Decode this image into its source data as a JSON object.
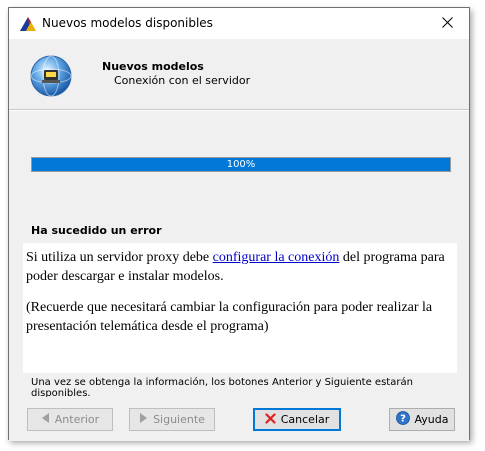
{
  "window": {
    "title": "Nuevos modelos disponibles"
  },
  "header": {
    "title": "Nuevos modelos",
    "subtitle": "Conexión con el servidor"
  },
  "progress": {
    "value": 1.0,
    "label": "100%"
  },
  "error": {
    "title": "Ha sucedido un error",
    "line1_before": "Si utiliza un servidor proxy debe ",
    "line1_link": "configurar la conexión",
    "line1_after": " del programa para poder descargar e instalar modelos.",
    "line2": "(Recuerde que necesitará cambiar la configuración para poder realizar la presentación telemática desde el programa)"
  },
  "footnote": "Una vez se obtenga la información, los botones Anterior y Siguiente estarán disponibles.",
  "buttons": {
    "back": "Anterior",
    "next": "Siguiente",
    "cancel": "Cancelar",
    "help": "Ayuda"
  },
  "colors": {
    "accent": "#0078d7",
    "link": "#0000cc",
    "cancel_icon": "#e02020"
  }
}
